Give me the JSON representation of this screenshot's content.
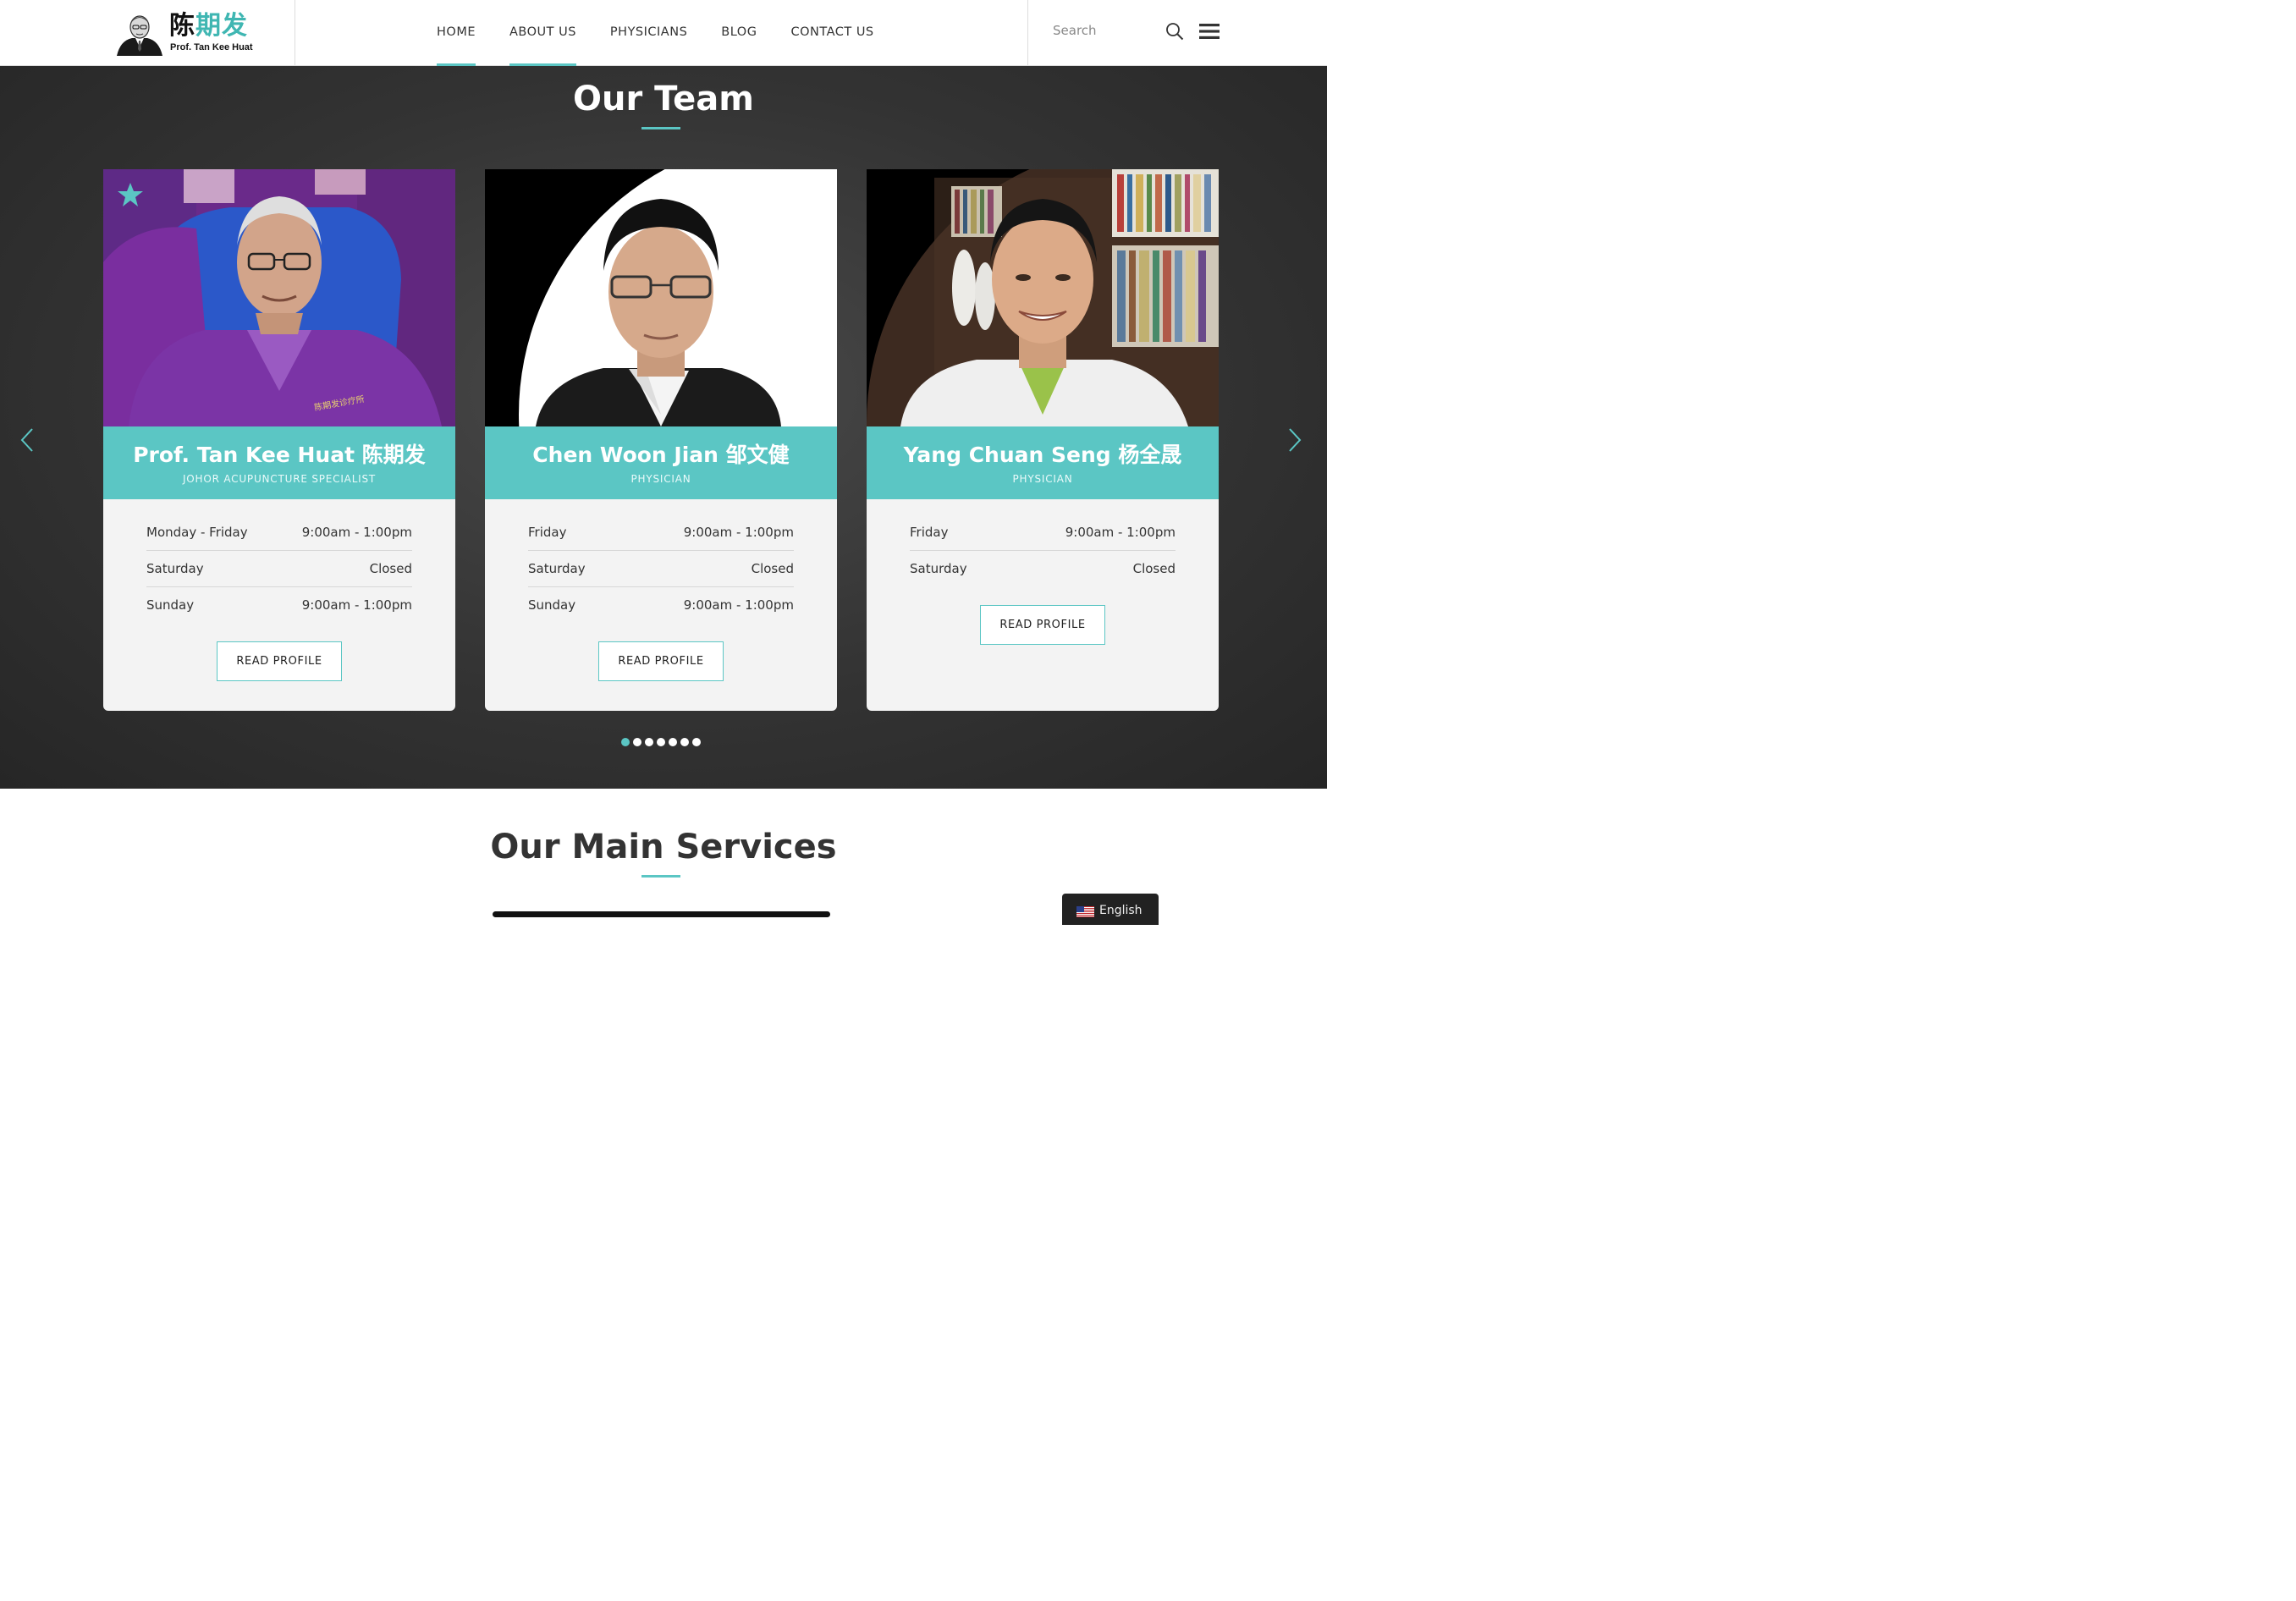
{
  "header": {
    "logo_cn_part1": "陈",
    "logo_cn_part2": "期发",
    "logo_en": "Prof. Tan Kee Huat",
    "nav": [
      {
        "label": "HOME",
        "active": true
      },
      {
        "label": "ABOUT US",
        "active": true
      },
      {
        "label": "PHYSICIANS",
        "active": false
      },
      {
        "label": "BLOG",
        "active": false
      },
      {
        "label": "CONTACT US",
        "active": false
      }
    ],
    "search_placeholder": "Search",
    "icons": [
      "search-icon",
      "hamburger-menu-icon"
    ]
  },
  "team": {
    "title": "Our Team",
    "cards": [
      {
        "name": "Prof. Tan Kee Huat 陈期发",
        "role": "JOHOR ACUPUNCTURE SPECIALIST",
        "featured": true,
        "hours": [
          {
            "day": "Monday - Friday",
            "time": "9:00am - 1:00pm"
          },
          {
            "day": "Saturday",
            "time": "Closed"
          },
          {
            "day": "Sunday",
            "time": "9:00am - 1:00pm"
          }
        ],
        "button": "READ PROFILE"
      },
      {
        "name": "Chen Woon Jian 邹文健",
        "role": "PHYSICIAN",
        "featured": false,
        "hours": [
          {
            "day": "Friday",
            "time": "9:00am - 1:00pm"
          },
          {
            "day": "Saturday",
            "time": "Closed"
          },
          {
            "day": "Sunday",
            "time": "9:00am - 1:00pm"
          }
        ],
        "button": "READ PROFILE"
      },
      {
        "name": "Yang Chuan Seng 杨全晟",
        "role": "PHYSICIAN",
        "featured": false,
        "hours": [
          {
            "day": "Friday",
            "time": "9:00am - 1:00pm"
          },
          {
            "day": "Saturday",
            "time": "Closed"
          }
        ],
        "button": "READ PROFILE"
      }
    ],
    "carousel": {
      "pages": 7,
      "active_page": 1
    }
  },
  "services": {
    "title": "Our Main Services"
  },
  "language": {
    "label": "English",
    "flag": "us-flag-icon"
  },
  "colors": {
    "accent": "#5bc6c4",
    "dark_bg": "#333333",
    "text": "#333333"
  }
}
